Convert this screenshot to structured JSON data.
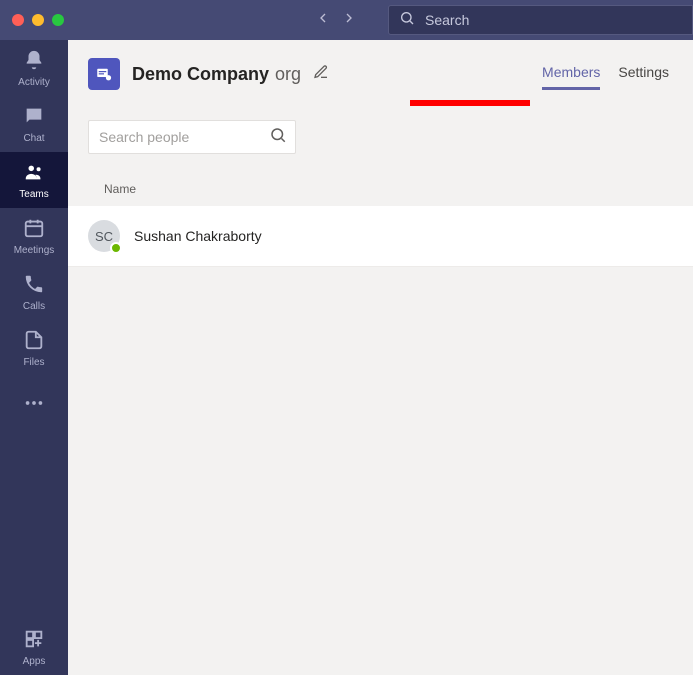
{
  "titlebar": {
    "search_placeholder": "Search"
  },
  "sidebar": {
    "items": [
      {
        "label": "Activity"
      },
      {
        "label": "Chat"
      },
      {
        "label": "Teams"
      },
      {
        "label": "Meetings"
      },
      {
        "label": "Calls"
      },
      {
        "label": "Files"
      }
    ],
    "apps_label": "Apps"
  },
  "team": {
    "name_bold": "Demo Company",
    "name_suffix": "org"
  },
  "tabs": {
    "members": "Members",
    "settings": "Settings",
    "active": "members"
  },
  "search_people": {
    "placeholder": "Search people"
  },
  "columns": {
    "name": "Name"
  },
  "members": [
    {
      "initials": "SC",
      "name": "Sushan Chakraborty",
      "presence": "available"
    }
  ]
}
